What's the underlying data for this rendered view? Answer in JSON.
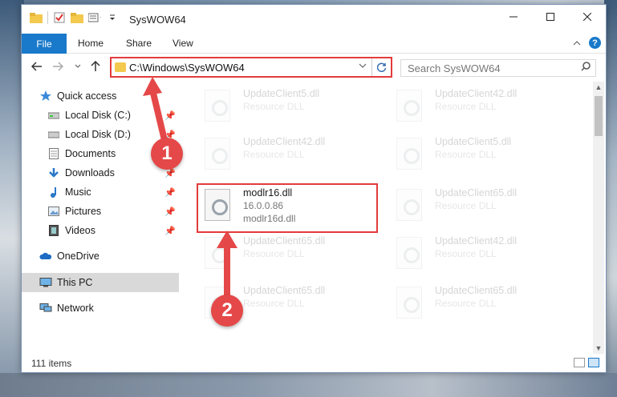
{
  "window": {
    "title": "SysWOW64"
  },
  "ribbon": {
    "tabs": [
      "File",
      "Home",
      "Share",
      "View"
    ],
    "help": "?"
  },
  "nav": {
    "address": "C:\\Windows\\SysWOW64",
    "search_placeholder": "Search SysWOW64"
  },
  "sidebar": {
    "items": [
      {
        "label": "Quick access",
        "icon": "star-icon"
      },
      {
        "label": "Local Disk (C:)",
        "icon": "drive-icon",
        "pinned": true
      },
      {
        "label": "Local Disk (D:)",
        "icon": "drive-icon",
        "pinned": true
      },
      {
        "label": "Documents",
        "icon": "documents-icon",
        "pinned": true
      },
      {
        "label": "Downloads",
        "icon": "downloads-icon",
        "pinned": true
      },
      {
        "label": "Music",
        "icon": "music-icon",
        "pinned": true
      },
      {
        "label": "Pictures",
        "icon": "pictures-icon",
        "pinned": true
      },
      {
        "label": "Videos",
        "icon": "videos-icon",
        "pinned": true
      },
      {
        "label": "OneDrive",
        "icon": "onedrive-icon"
      },
      {
        "label": "This PC",
        "icon": "pc-icon",
        "selected": true
      },
      {
        "label": "Network",
        "icon": "network-icon"
      }
    ]
  },
  "files": {
    "left": [
      {
        "name": "UpdateClient5.dll",
        "type": "Resource DLL",
        "faded": true
      },
      {
        "name": "UpdateClient42.dll",
        "type": "Resource DLL",
        "faded": true
      },
      {
        "name": "modlr16.dll",
        "version": "16.0.0.86",
        "desc": "modlr16d.dll",
        "faded": false
      },
      {
        "name": "UpdateClient65.dll",
        "type": "Resource DLL",
        "faded": true
      },
      {
        "name": "UpdateClient65.dll",
        "type": "Resource DLL",
        "faded": true
      }
    ],
    "right": [
      {
        "name": "UpdateClient42.dll",
        "type": "Resource DLL"
      },
      {
        "name": "UpdateClient5.dll",
        "type": "Resource DLL"
      },
      {
        "name": "UpdateClient65.dll",
        "type": "Resource DLL"
      },
      {
        "name": "UpdateClient42.dll",
        "type": "Resource DLL"
      },
      {
        "name": "UpdateClient65.dll",
        "type": "Resource DLL"
      }
    ]
  },
  "status": {
    "item_count": "111 items"
  },
  "annotations": {
    "badge1": "1",
    "badge2": "2"
  },
  "colors": {
    "accent": "#1979ca",
    "annotation": "#e33b3b"
  }
}
